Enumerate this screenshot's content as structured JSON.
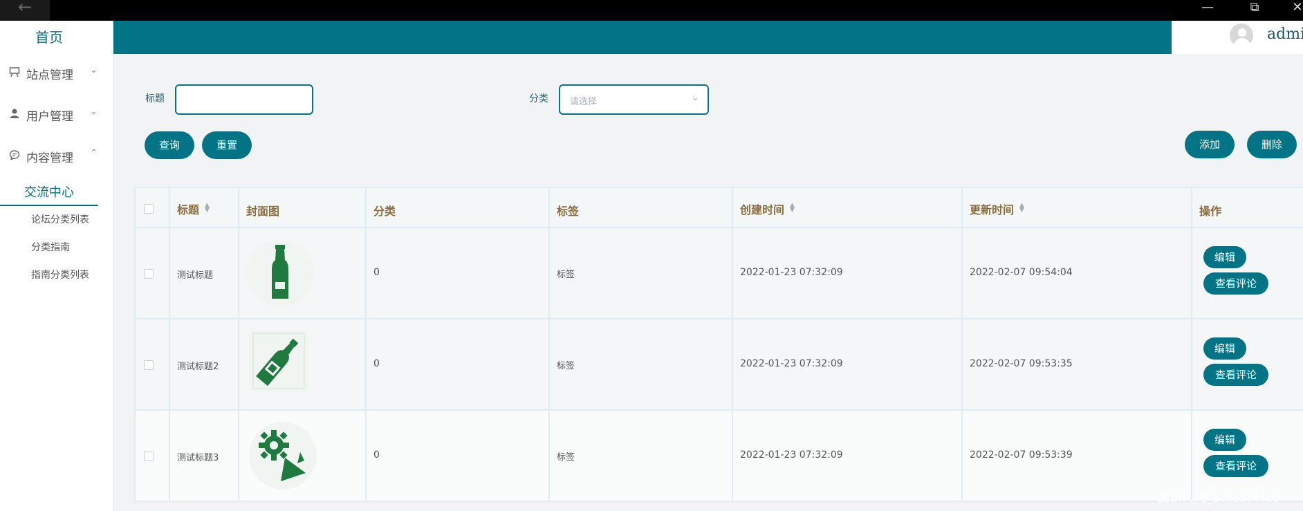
{
  "window": {
    "back_glyph": "←",
    "min_glyph": "—",
    "restore_glyph": "⧉",
    "close_glyph": "✕"
  },
  "header": {
    "user": "admin"
  },
  "sidebar": {
    "home": "首页",
    "menus": [
      {
        "label": "站点管理",
        "icon": "billboard-icon",
        "arrow": "⌄"
      },
      {
        "label": "用户管理",
        "icon": "user-icon",
        "arrow": "⌄"
      },
      {
        "label": "内容管理",
        "icon": "chat-icon",
        "arrow": "⌃"
      }
    ],
    "active_sub": "交流中心",
    "sub_items": [
      "论坛分类列表",
      "分类指南",
      "指南分类列表"
    ]
  },
  "search": {
    "title_label": "标题",
    "title_value": "",
    "category_label": "分类",
    "category_placeholder": "请选择",
    "query_btn": "查询",
    "reset_btn": "重置",
    "add_btn": "添加",
    "delete_btn": "删除"
  },
  "table": {
    "headers": [
      "标题",
      "封面图",
      "分类",
      "标签",
      "创建时间",
      "更新时间",
      "操作"
    ],
    "rows": [
      {
        "title": "测试标题",
        "cover": "bottle-icon",
        "category": "0",
        "tag": "标签",
        "created": "2022-01-23 07:32:09",
        "updated": "2022-02-07 09:54:04"
      },
      {
        "title": "测试标题2",
        "cover": "sauce-bottle-icon",
        "category": "0",
        "tag": "标签",
        "created": "2022-01-23 07:32:09",
        "updated": "2022-02-07 09:53:35"
      },
      {
        "title": "测试标题3",
        "cover": "gear-carrot-icon",
        "category": "0",
        "tag": "标签",
        "created": "2022-01-23 07:32:09",
        "updated": "2022-02-07 09:53:39"
      }
    ],
    "edit_btn": "编辑",
    "comment_btn": "查看评论"
  },
  "watermark": "CSDN @Q_3461074420",
  "colors": {
    "primary": "#037485",
    "header_text": "#8a6d3b",
    "icon_green": "#1e7a3f"
  }
}
